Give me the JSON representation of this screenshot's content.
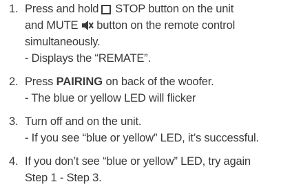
{
  "steps": [
    {
      "number": "1.",
      "line1_a": "Press and hold",
      "stop_icon": "stop-square-icon",
      "line1_b": "STOP button on the unit",
      "line2_a": "and MUTE",
      "mute_icon": "speaker-mute-icon",
      "line2_b": "button on the remote control",
      "line3": "simultaneously.",
      "line4": "- Displays the “REMATE”."
    },
    {
      "number": "2.",
      "line1_a": "Press",
      "line1_bold": "PAIRING",
      "line1_b": "on back of the woofer.",
      "line2": "- The blue or yellow LED will flicker"
    },
    {
      "number": "3.",
      "line1": "Turn off and on the unit.",
      "line2": "- If you see “blue or yellow” LED, it’s successful."
    },
    {
      "number": "4.",
      "line1": "If you don’t see “blue or yellow” LED, try again",
      "line2": "Step 1 - Step 3."
    }
  ]
}
